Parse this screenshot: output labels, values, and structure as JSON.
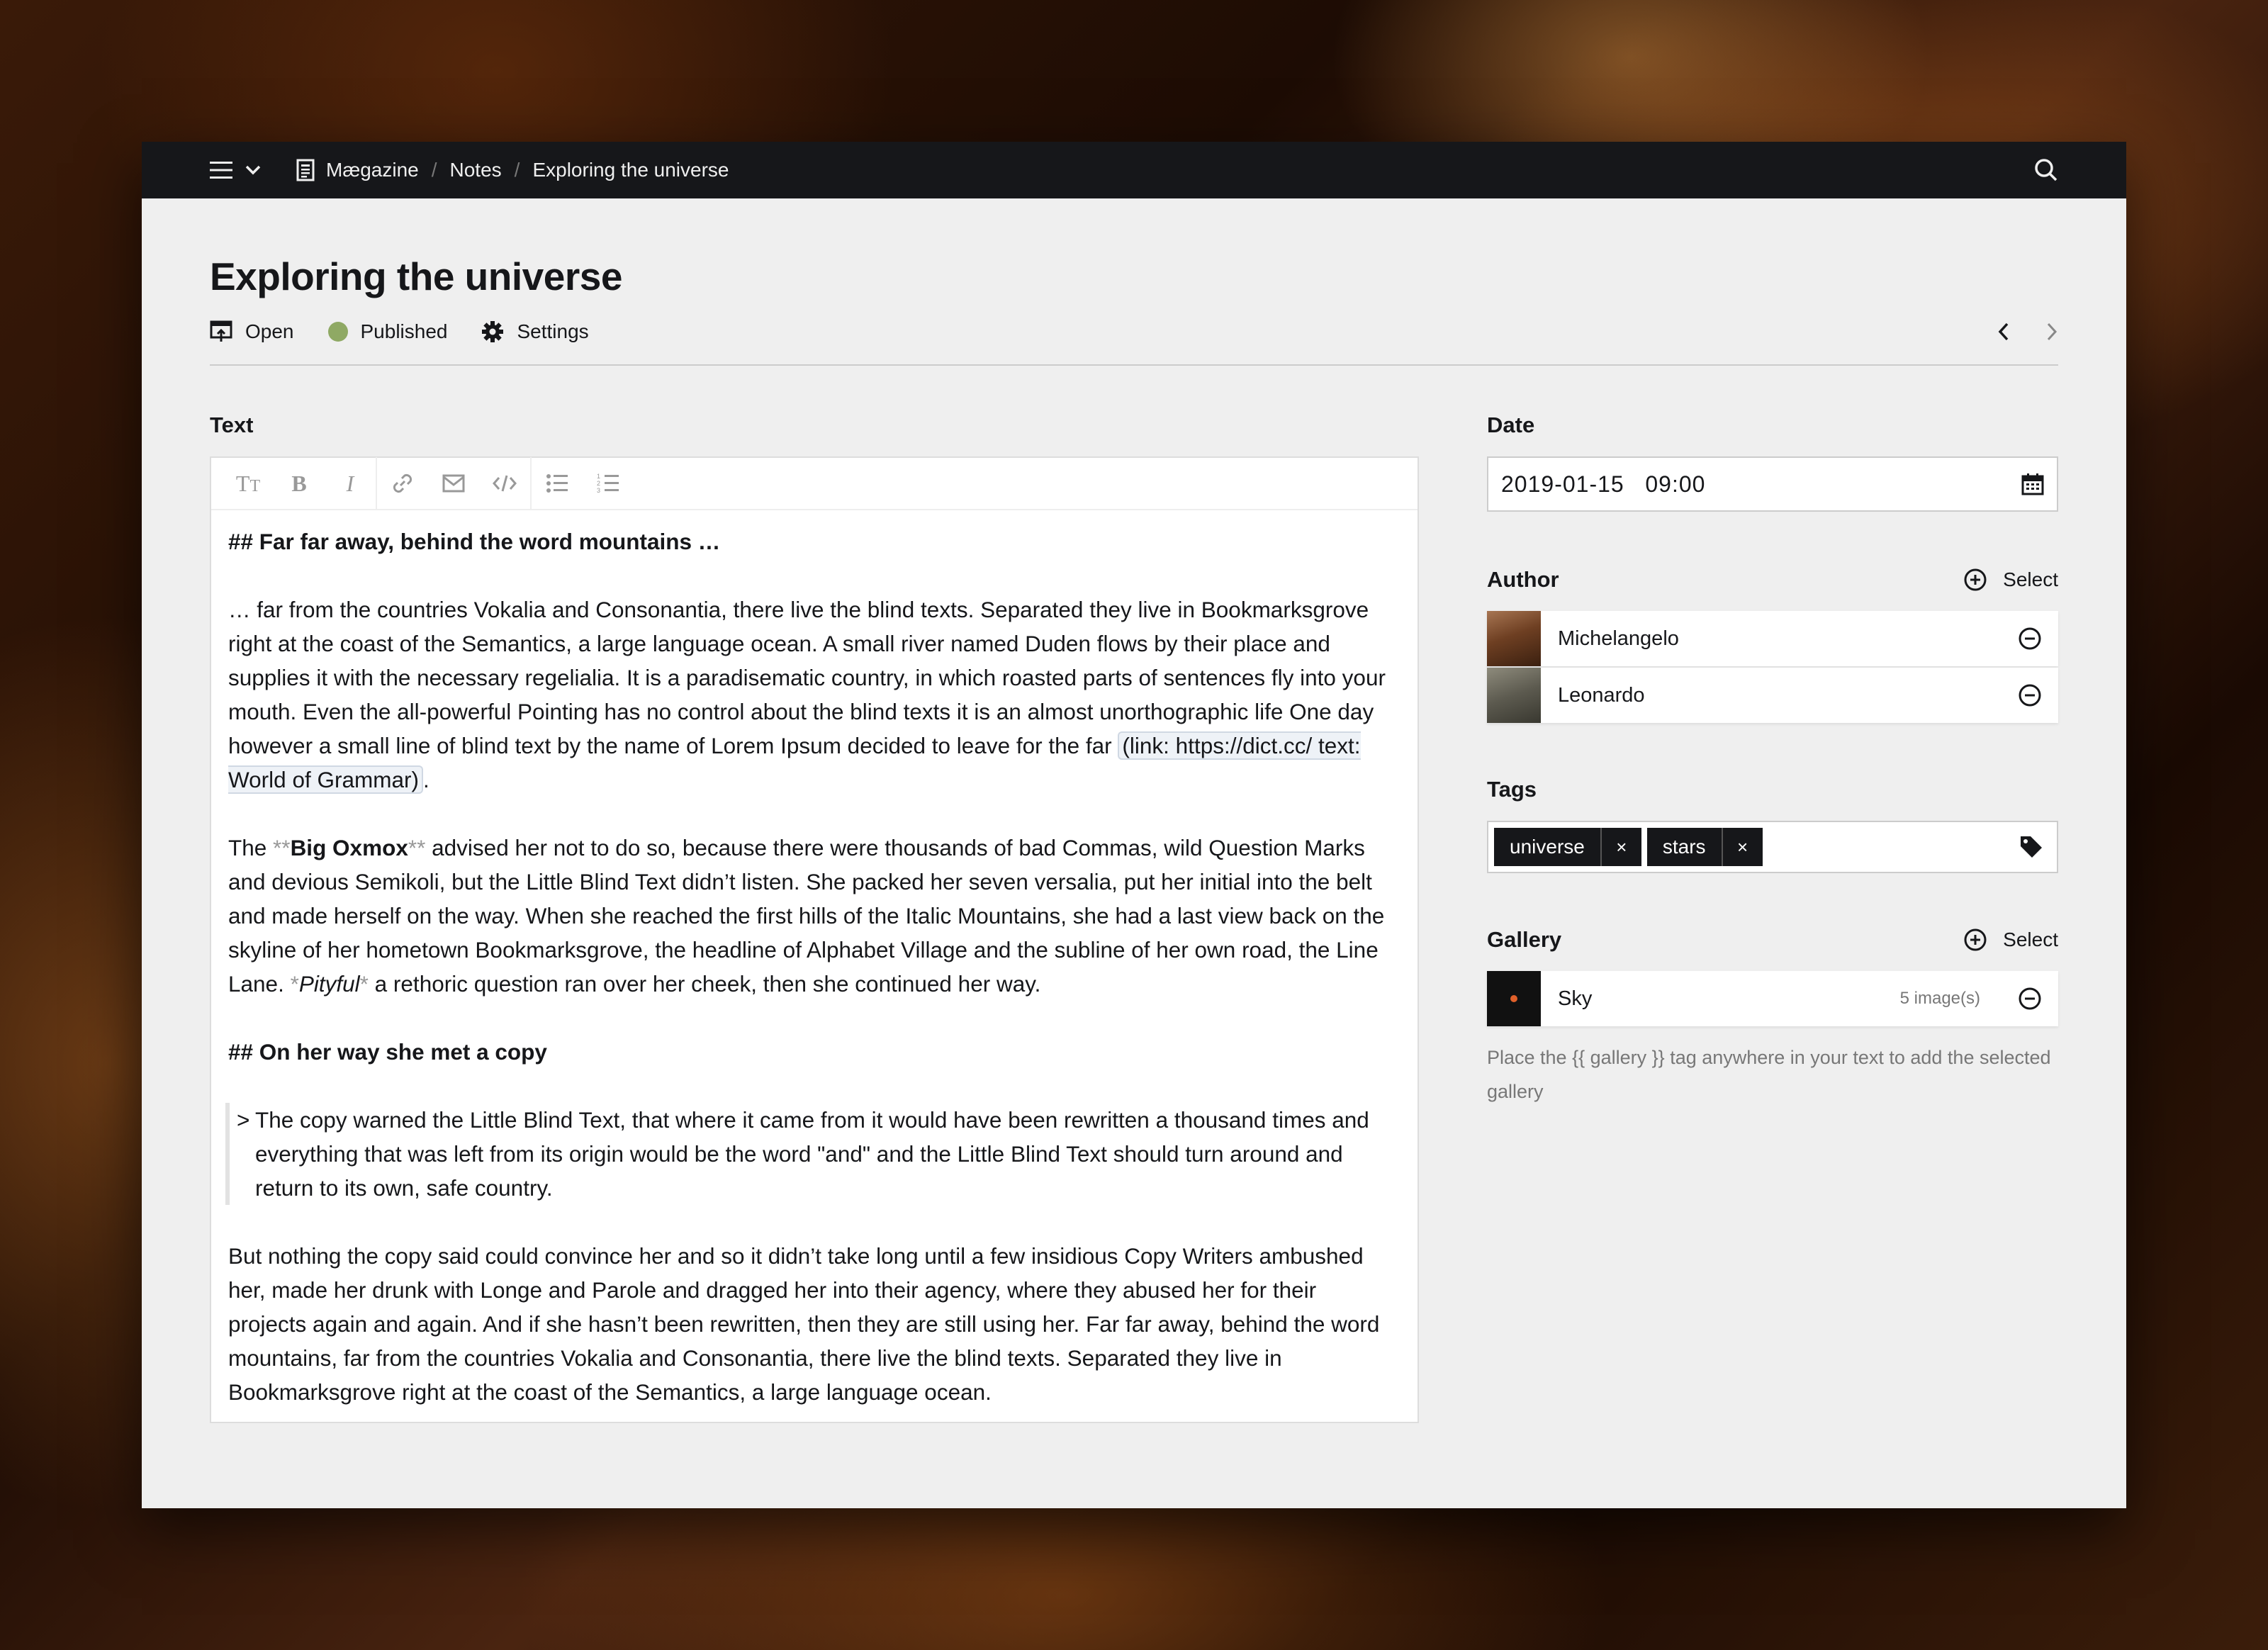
{
  "topbar": {
    "breadcrumb": [
      {
        "label": "Mægazine",
        "icon": "page-icon"
      },
      {
        "label": "Notes"
      },
      {
        "label": "Exploring the universe"
      }
    ]
  },
  "page": {
    "title": "Exploring the universe",
    "options": {
      "open": "Open",
      "status": "Published",
      "settings": "Settings"
    },
    "status_color": "#8fa964"
  },
  "text_field": {
    "label": "Text",
    "toolbar": [
      "title-icon",
      "bold-icon",
      "italic-icon",
      "link-icon",
      "email-icon",
      "code-icon",
      "bullet-list-icon",
      "ordered-list-icon"
    ],
    "heading1": "## Far far away, behind the word mountains …",
    "p1": "… far from the countries Vokalia and Consonantia, there live the blind texts. Separated they live in Bookmarksgrove right at the coast of the Semantics, a large language ocean. A small river named Duden flows by their place and supplies it with the necessary regelialia. It is a paradisematic country, in which roasted parts of sentences fly into your mouth. Even the all-powerful Pointing has no control about the blind texts it is an almost unorthographic life One day however a small line of blind text by the name of Lorem Ipsum decided to leave for the far ",
    "p1_link": "(link: https://dict.cc/ text: World of Grammar)",
    "p1_end": ".",
    "p2_start": "The ",
    "p2_bold_open": "**",
    "p2_bold": "Big Oxmox",
    "p2_bold_close": "**",
    "p2_mid": " advised her not to do so, because there were thousands of bad Commas, wild Question Marks and devious Semikoli, but the Little Blind Text didn’t listen. She packed her seven versalia, put her initial into the belt and made herself on the way. When she reached the first hills of the Italic Mountains, she had a last view back on the skyline of her hometown Bookmarksgrove, the headline of Alphabet Village and the subline of her own road, the Line Lane. ",
    "p2_italic_open": "*",
    "p2_italic": "Pityful",
    "p2_italic_close": "*",
    "p2_end": " a rethoric question ran over her cheek, then she continued her way.",
    "heading2": "## On her way she met a copy",
    "quote_mark": ">",
    "quote": "The copy warned the Little Blind Text, that where it came from it would have been rewritten a thousand times and everything that was left from its origin would be the word \"and\" and the Little Blind Text should turn around and return to its own, safe country.",
    "p3": "But nothing the copy said could convince her and so it didn’t take long until a few insidious Copy Writers ambushed her, made her drunk with Longe and Parole and dragged her into their agency, where they abused her for their projects again and again. And if she hasn’t been rewritten, then they are still using her. Far far away, behind the word mountains, far from the countries Vokalia and Consonantia, there live the blind texts. Separated they live in Bookmarksgrove right at the coast of the Semantics, a large language ocean."
  },
  "date_field": {
    "label": "Date",
    "value": "2019-01-15   09:00"
  },
  "author_field": {
    "label": "Author",
    "select": "Select",
    "items": [
      {
        "name": "Michelangelo"
      },
      {
        "name": "Leonardo"
      }
    ]
  },
  "tags_field": {
    "label": "Tags",
    "tags": [
      "universe",
      "stars"
    ],
    "remove": "×"
  },
  "gallery_field": {
    "label": "Gallery",
    "select": "Select",
    "item": {
      "name": "Sky",
      "info": "5 image(s)"
    },
    "help": "Place the {{ gallery }} tag anywhere in your text to add the selected gallery"
  }
}
